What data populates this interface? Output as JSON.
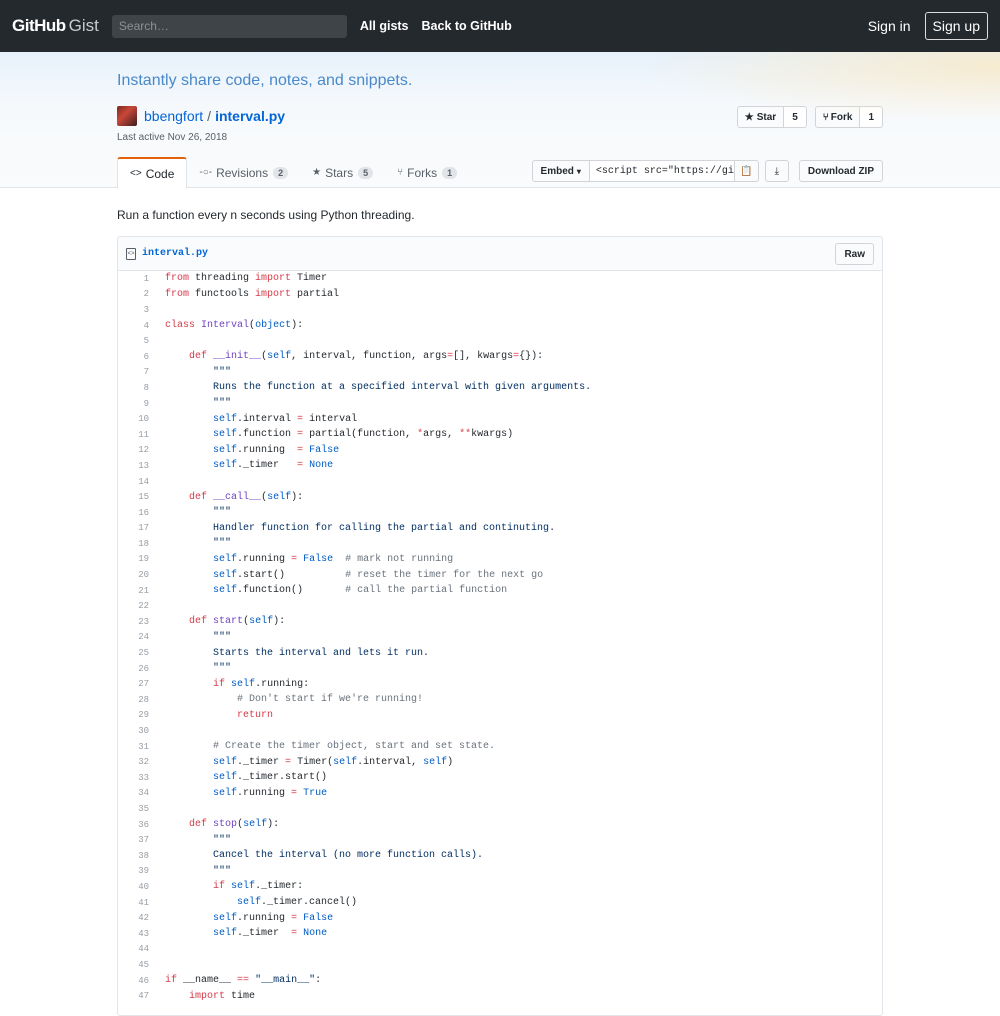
{
  "header": {
    "logo_main": "GitHub",
    "logo_sub": "Gist",
    "search_placeholder": "Search…",
    "nav": [
      "All gists",
      "Back to GitHub"
    ],
    "sign_in": "Sign in",
    "sign_up": "Sign up"
  },
  "banner": {
    "tagline": "Instantly share code, notes, and snippets.",
    "owner": "bbengfort",
    "separator": "/",
    "gist_name": "interval.py",
    "last_active": "Last active Nov 26, 2018",
    "star_label": "Star",
    "star_count": "5",
    "fork_label": "Fork",
    "fork_count": "1"
  },
  "tabs": [
    {
      "label": "Code",
      "icon": "code-icon",
      "count": ""
    },
    {
      "label": "Revisions",
      "icon": "revisions-icon",
      "count": "2"
    },
    {
      "label": "Stars",
      "icon": "star-icon",
      "count": "5"
    },
    {
      "label": "Forks",
      "icon": "fork-icon",
      "count": "1"
    }
  ],
  "embed": {
    "label": "Embed",
    "value": "<script src=\"https://gist",
    "download_zip": "Download ZIP"
  },
  "description": "Run a function every n seconds using Python threading.",
  "file": {
    "name": "interval.py",
    "raw_label": "Raw"
  },
  "code_lines": [
    "from threading import Timer",
    "from functools import partial",
    "",
    "class Interval(object):",
    "",
    "    def __init__(self, interval, function, args=[], kwargs={}):",
    "        \"\"\"",
    "        Runs the function at a specified interval with given arguments.",
    "        \"\"\"",
    "        self.interval = interval",
    "        self.function = partial(function, *args, **kwargs)",
    "        self.running  = False",
    "        self._timer   = None",
    "",
    "    def __call__(self):",
    "        \"\"\"",
    "        Handler function for calling the partial and continuting.",
    "        \"\"\"",
    "        self.running = False  # mark not running",
    "        self.start()          # reset the timer for the next go",
    "        self.function()       # call the partial function",
    "",
    "    def start(self):",
    "        \"\"\"",
    "        Starts the interval and lets it run.",
    "        \"\"\"",
    "        if self.running:",
    "            # Don't start if we're running!",
    "            return",
    "",
    "        # Create the timer object, start and set state.",
    "        self._timer = Timer(self.interval, self)",
    "        self._timer.start()",
    "        self.running = True",
    "",
    "    def stop(self):",
    "        \"\"\"",
    "        Cancel the interval (no more function calls).",
    "        \"\"\"",
    "        if self._timer:",
    "            self._timer.cancel()",
    "        self.running = False",
    "        self._timer  = None",
    "",
    "",
    "if __name__ == \"__main__\":",
    "    import time"
  ]
}
